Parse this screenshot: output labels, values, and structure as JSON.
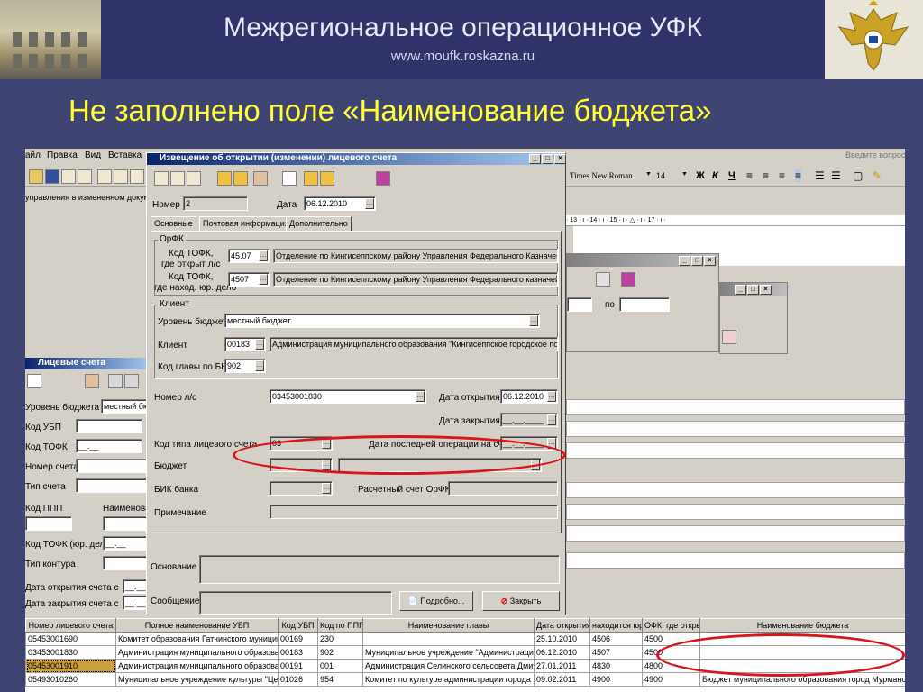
{
  "banner": {
    "title": "Межрегиональное операционное УФК",
    "url": "www.moufk.roskazna.ru"
  },
  "slide_title": "Не заполнено поле «Наименование бюджета»",
  "background_app": {
    "menu": [
      "айл",
      "Правка",
      "Вид",
      "Вставка"
    ],
    "breadcrumb": "управления в измененном докумен",
    "font_name": "Times New Roman",
    "font_size": "14",
    "format_buttons": [
      "Ж",
      "К",
      "Ч"
    ],
    "ruler": "· 13 · ı · 14 · ı · 15 · ı · △ · ı · 17 · ı ·",
    "search_hint": "Введите вопрос"
  },
  "accounts_window": {
    "title": "Лицевые счета",
    "fields": [
      {
        "label": "Уровень бюджета",
        "value": "местный бю"
      },
      {
        "label": "Код УБП",
        "value": ""
      },
      {
        "label": "Код ТОФК",
        "value": "__.__"
      },
      {
        "label": "Номер счета",
        "value": ""
      },
      {
        "label": "Тип счета",
        "value": ""
      },
      {
        "label": "Код ППП",
        "value": ""
      },
      {
        "label": "Наименова",
        "value": ""
      },
      {
        "label": "Код ТОФК (юр. дело)",
        "value": "__.__"
      },
      {
        "label": "Тип контура",
        "value": ""
      },
      {
        "label": "Дата открытия счета с",
        "value": "__.__"
      },
      {
        "label": "Дата закрытия счета с",
        "value": "__.__"
      }
    ]
  },
  "small_window": {
    "to_label": "по"
  },
  "dialog": {
    "title": "Извещение об открытии (изменении) лицевого счета",
    "number_label": "Номер",
    "number_value": "2",
    "date_label": "Дата",
    "date_value": "06.12.2010",
    "tabs": [
      "Основные",
      "Почтовая информация",
      "Дополнительно"
    ],
    "orfk_group": "ОрФК",
    "tofk_open_label1": "Код ТОФК,",
    "tofk_open_label2": "где открыт л/с",
    "tofk_open_code": "45.07",
    "tofk_open_name": "Отделение по Кингисеппскому району Управления Федерального Казначейс",
    "tofk_legal_label1": "Код ТОФК,",
    "tofk_legal_label2": "где наход. юр. дело",
    "tofk_legal_code": "4507",
    "tofk_legal_name": "Отделение по Кингисеппскому району Управления Федерального казначейс",
    "client_group": "Клиент",
    "budget_level_label": "Уровень бюджета",
    "budget_level_value": "местный бюджет",
    "client_label": "Клиент",
    "client_code": "00183",
    "client_name": "Администрация муниципального образования \"Кингисеппское городское посе",
    "chapter_label": "Код главы по БК",
    "chapter_value": "902",
    "account_label": "Номер л/с",
    "account_value": "03453001830",
    "open_date_label": "Дата открытия",
    "open_date_value": "06.12.2010",
    "close_date_label": "Дата закрытия",
    "close_date_value": "__.__.____",
    "acc_type_label": "Код типа лицевого счета",
    "acc_type_value": "03",
    "last_op_label": "Дата последней операции на счете",
    "last_op_value": "__.__.____",
    "budget_label": "Бюджет",
    "budget_code": "",
    "budget_name": "",
    "bik_label": "БИК банка",
    "settle_label": "Расчетный счет ОрФК",
    "note_label": "Примечание",
    "basis_label": "Основание",
    "message_label": "Сообщение",
    "details_button": "Подробно...",
    "close_button": "Закрыть"
  },
  "table": {
    "headers": [
      "Номер лицевого счета",
      "Полное наименование УБП",
      "Код УБП",
      "Код по ППП",
      "Наименование главы",
      "Дата открытия",
      "находится юр",
      "ОФК, где откры",
      "Наименование бюджета"
    ],
    "rows": [
      [
        "05453001690",
        "Комитет образования Гатчинского муницип",
        "00169",
        "230",
        "",
        "25.10.2010",
        "4506",
        "4500",
        ""
      ],
      [
        "03453001830",
        "Администрация муниципального образован",
        "00183",
        "902",
        "Муниципальное учреждение \"Администрация Ш",
        "06.12.2010",
        "4507",
        "4500",
        ""
      ],
      [
        "05453001910",
        "Администрация муниципального образован",
        "00191",
        "001",
        "Администрация Селинского сельсовета Дмитр",
        "27.01.2011",
        "4830",
        "4800",
        ""
      ],
      [
        "05493010260",
        "Муниципальное учреждение культуры \"Цент",
        "01026",
        "954",
        "Комитет по культуре администрации города Мур",
        "09.02.2011",
        "4900",
        "4900",
        "Бюджет муниципального образования город Мурманск"
      ]
    ]
  },
  "colors": {
    "slide_bg": "#3f4372",
    "title_yellow": "#ffff33",
    "highlight_red": "#d8141c",
    "window_titlebar": "#0a246a"
  }
}
